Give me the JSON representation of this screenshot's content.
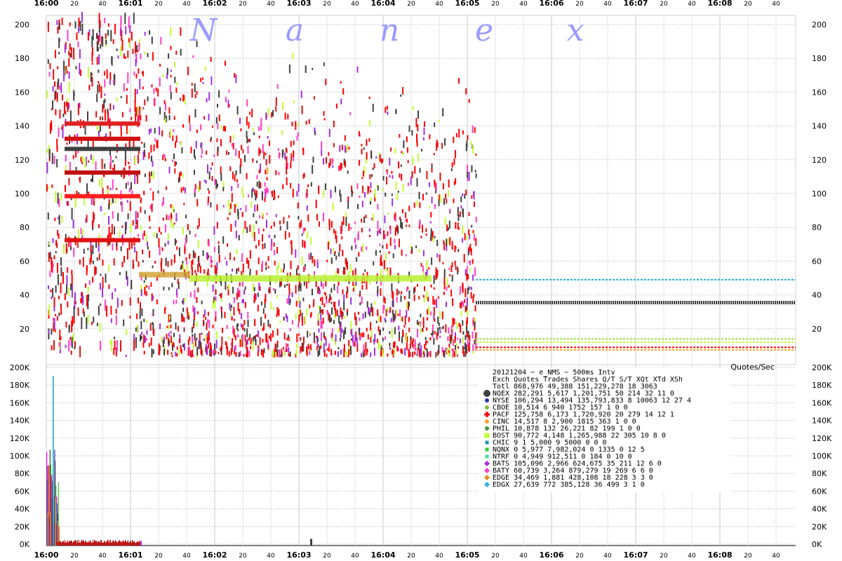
{
  "chart_data": [
    {
      "type": "scatter",
      "panel": "price",
      "watermark": [
        "N",
        "a",
        "n",
        "e",
        "x"
      ],
      "x_major_labels": [
        "16:00",
        "16:01",
        "16:02",
        "16:03",
        "16:04",
        "16:05",
        "16:06",
        "16:07",
        "16:08"
      ],
      "x_minor_labels": [
        "20",
        "40"
      ],
      "yticks": [
        20,
        40,
        60,
        80,
        100,
        120,
        140,
        160,
        180,
        200
      ],
      "ylim": [
        0,
        205
      ],
      "grid": true,
      "data_end_label": "16:05",
      "flat_lines_after_close": [
        {
          "exchange": "CHIC",
          "price": 49,
          "color": "#1ab0d0"
        },
        {
          "exchange": "NQEX",
          "price": 35.5,
          "color": "#404040"
        },
        {
          "exchange": "PHIL",
          "price": 14,
          "color": "#a0e040"
        },
        {
          "exchange": "BOST",
          "price": 12,
          "color": "#c0ff30"
        },
        {
          "exchange": "PACF",
          "price": 9,
          "color": "#ff0000"
        },
        {
          "exchange": "CINC",
          "price": 7.5,
          "color": "#ffa020"
        }
      ]
    },
    {
      "type": "bar",
      "panel": "rate",
      "title": "Quotes/Sec",
      "yticks": [
        "0K",
        "20K",
        "40K",
        "60K",
        "80K",
        "100K",
        "120K",
        "140K",
        "160K",
        "180K",
        "200K"
      ],
      "ylim": [
        0,
        200000
      ],
      "peak": {
        "time": "16:00:05",
        "value": 190000
      }
    }
  ],
  "legend": {
    "title": "20121204 ~ e_NMS ~ 500ms Intv",
    "header": "Exch  Quotes Trades        Shares   Q/T    S/T  XQt XTd  XSh",
    "total": "Totl 868,976 49,388 151,229,278    18   3063",
    "rows": [
      {
        "exch": "NQEX",
        "color": "#404040",
        "marker": "circle-large",
        "text": "NQEX 282,291  5,617   1,201,751    50    214   32  11    0"
      },
      {
        "exch": "NYSE",
        "color": "#3030c0",
        "marker": "circle",
        "text": "NYSE 106,294 13,494 135,793,833     8  10063   12  27    4"
      },
      {
        "exch": "CBOE",
        "color": "#80c040",
        "marker": "circle",
        "text": "CBOE  10,514      6         940  1752    157    1   0    0"
      },
      {
        "exch": "PACF",
        "color": "#ff0000",
        "marker": "cross",
        "text": "PACF 125,758  6,173   1,720,920    20    279   14  12    1"
      },
      {
        "exch": "CINC",
        "color": "#ffa020",
        "marker": "circle",
        "text": "CINC  14,517      8       2,900  1815    363    1   0    0"
      },
      {
        "exch": "PHIL",
        "color": "#40a040",
        "marker": "circle",
        "text": "PHIL  10,878    132      26,221    82    199    1   0    0"
      },
      {
        "exch": "BOST",
        "color": "#c0ff30",
        "marker": "square",
        "text": "BOST  90,772  4,148   1,265,988    22    305   10   8    0"
      },
      {
        "exch": "CHIC",
        "color": "#2090c0",
        "marker": "square-small",
        "text": "CHIC       9      1       5,000     9   5000    0   0    0"
      },
      {
        "exch": "NQNX",
        "color": "#30d030",
        "marker": "square-small",
        "text": "NQNX       0  5,977   7,982,024     0   1335    0  12    5"
      },
      {
        "exch": "NTRF",
        "color": "#40e0a0",
        "marker": "square-small",
        "text": "NTRF       0  4,949     912,511     0    184    0  10    0"
      },
      {
        "exch": "BATS",
        "color": "#a030e0",
        "marker": "diamond",
        "text": "BATS 105,096  2,966     624,675    35    211   12   6    0"
      },
      {
        "exch": "BATY",
        "color": "#ff40c0",
        "marker": "diamond",
        "text": "BATY  60,739  3,264     879,279    19    269    6   6    0"
      },
      {
        "exch": "EDGE",
        "color": "#e09020",
        "marker": "diamond",
        "text": "EDGE  34,469  1,881     428,108    18    228    3   3    0"
      },
      {
        "exch": "EDGX",
        "color": "#30b0e0",
        "marker": "diamond",
        "text": "EDGX  27,639    772     385,128    36    499    3   1    0"
      }
    ]
  },
  "colors": {
    "grid": "#c8c8c8",
    "background": "#ffffff",
    "watermark": "#9a9aff"
  }
}
